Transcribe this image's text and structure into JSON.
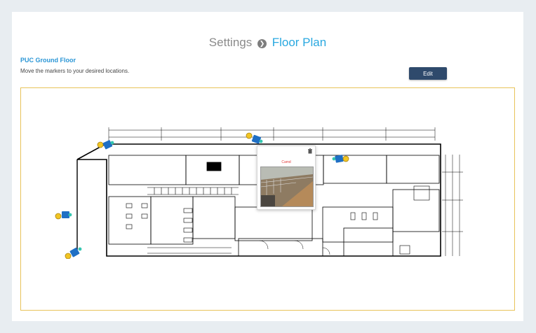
{
  "header": {
    "breadcrumb_parent": "Settings",
    "breadcrumb_separator": "❯",
    "breadcrumb_current": "Floor Plan"
  },
  "floor_plan": {
    "name": "PUC Ground Floor",
    "instructions": "Move the markers to your desired locations.",
    "edit_label": "Edit"
  },
  "camera_popup": {
    "label": "Camd"
  },
  "icons": {
    "separator": "chevron-right-circle-icon",
    "marker": "camera-icon",
    "close": "trash-icon"
  },
  "colors": {
    "accent": "#29a8e0",
    "button": "#2f4a6c",
    "frame_border": "#e8c35a",
    "marker_blue": "#1f6fc4",
    "marker_yellow": "#f2c523",
    "marker_teal": "#35c6b0"
  }
}
